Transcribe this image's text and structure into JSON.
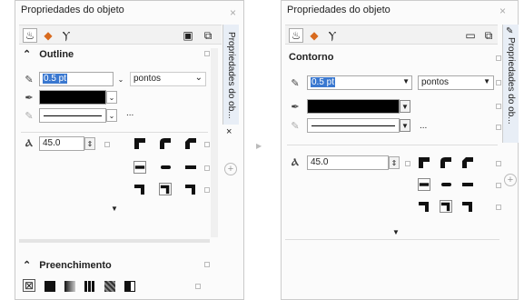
{
  "left": {
    "title": "Propriedades do objeto",
    "outline_label": "Outline",
    "width_value": "0.5 pt",
    "units_value": "pontos",
    "ellipsis": "...",
    "miter_value": "45.0",
    "fill_label": "Preenchimento",
    "vtab_label": "Propriedades do ob...",
    "vtab_close": "×"
  },
  "right": {
    "title": "Propriedades do objeto",
    "outline_label": "Contorno",
    "width_value": "0.5 pt",
    "units_value": "pontos",
    "ellipsis": "...",
    "miter_value": "45.0",
    "vtab_label": "Propriedades do ob..."
  },
  "colors": {
    "selection": "#3a78d0",
    "black_swatch": "#000000",
    "panel_bg": "#fbfbfb"
  }
}
